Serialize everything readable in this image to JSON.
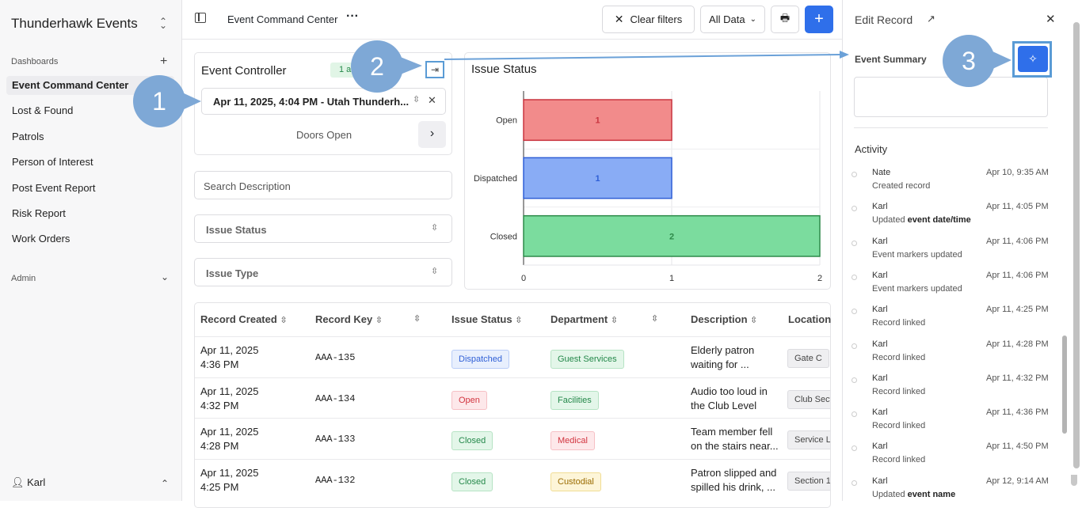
{
  "sidebar": {
    "brand": "Thunderhawk Events",
    "dashboards_label": "Dashboards",
    "items": [
      "Event Command Center",
      "Lost & Found",
      "Patrols",
      "Person of Interest",
      "Post Event Report",
      "Risk Report",
      "Work Orders"
    ],
    "admin_label": "Admin",
    "user": "Karl"
  },
  "header": {
    "title": "Event Command Center",
    "clear_filters": "Clear filters",
    "data_select": "All Data"
  },
  "controller": {
    "title": "Event Controller",
    "badge": "1 ac",
    "event_value": "Apr 11, 2025, 4:04 PM - Utah Thunderh...",
    "step_label": "Doors Open"
  },
  "filters": {
    "search_placeholder": "Search Description",
    "issue_status": "Issue Status",
    "issue_type": "Issue Type"
  },
  "chart_data": {
    "type": "bar",
    "title": "Issue Status",
    "orientation": "horizontal",
    "categories": [
      "Open",
      "Dispatched",
      "Closed"
    ],
    "values": [
      1,
      1,
      2
    ],
    "xlim": [
      0,
      2
    ],
    "xticks": [
      "0",
      "1",
      "2"
    ],
    "colors": [
      "#f28b8b",
      "#89acf5",
      "#7bdc9e"
    ],
    "borders": [
      "#c9343f",
      "#2f5fd6",
      "#2e8a4a"
    ]
  },
  "table": {
    "headers": [
      "Record Created",
      "Record Key",
      "Issue Status",
      "Department",
      "Description",
      "Location"
    ],
    "rows": [
      {
        "created1": "Apr 11, 2025",
        "created2": "4:36 PM",
        "key": "AAA-135",
        "status": "Dispatched",
        "dept": "Guest Services",
        "desc1": "Elderly patron",
        "desc2": "waiting for ...",
        "loc": "Gate C"
      },
      {
        "created1": "Apr 11, 2025",
        "created2": "4:32 PM",
        "key": "AAA-134",
        "status": "Open",
        "dept": "Facilities",
        "desc1": "Audio too loud in",
        "desc2": "the Club Level",
        "loc": "Club Sect"
      },
      {
        "created1": "Apr 11, 2025",
        "created2": "4:28 PM",
        "key": "AAA-133",
        "status": "Closed",
        "dept": "Medical",
        "desc1": "Team member fell",
        "desc2": "on the stairs near...",
        "loc": "Service L"
      },
      {
        "created1": "Apr 11, 2025",
        "created2": "4:25 PM",
        "key": "AAA-132",
        "status": "Closed",
        "dept": "Custodial",
        "desc1": "Patron slipped and",
        "desc2": "spilled his drink, ...",
        "loc": "Section 1"
      }
    ]
  },
  "record": {
    "title": "Edit Record",
    "summary_label": "Event Summary",
    "activity_label": "Activity",
    "activity": [
      {
        "name": "Nate",
        "text": "Created record",
        "bold": "",
        "time": "Apr 10, 9:35 AM"
      },
      {
        "name": "Karl",
        "text": "Updated ",
        "bold": "event date/time",
        "time": "Apr 11, 4:05 PM"
      },
      {
        "name": "Karl",
        "text": "Event markers updated",
        "bold": "",
        "time": "Apr 11, 4:06 PM"
      },
      {
        "name": "Karl",
        "text": "Event markers updated",
        "bold": "",
        "time": "Apr 11, 4:06 PM"
      },
      {
        "name": "Karl",
        "text": "Record linked",
        "bold": "",
        "time": "Apr 11, 4:25 PM"
      },
      {
        "name": "Karl",
        "text": "Record linked",
        "bold": "",
        "time": "Apr 11, 4:28 PM"
      },
      {
        "name": "Karl",
        "text": "Record linked",
        "bold": "",
        "time": "Apr 11, 4:32 PM"
      },
      {
        "name": "Karl",
        "text": "Record linked",
        "bold": "",
        "time": "Apr 11, 4:36 PM"
      },
      {
        "name": "Karl",
        "text": "Record linked",
        "bold": "",
        "time": "Apr 11, 4:50 PM"
      },
      {
        "name": "Karl",
        "text": "Updated ",
        "bold": "event name",
        "time": "Apr 12, 9:14 AM"
      }
    ]
  },
  "callouts": [
    "1",
    "2",
    "3"
  ],
  "status_colors": {
    "Dispatched": "#2f5fd6",
    "Open": "#d2343f",
    "Closed": "#24884a"
  },
  "dept_colors": {
    "Guest Services": "green",
    "Facilities": "green",
    "Medical": "red",
    "Custodial": "yellow"
  }
}
